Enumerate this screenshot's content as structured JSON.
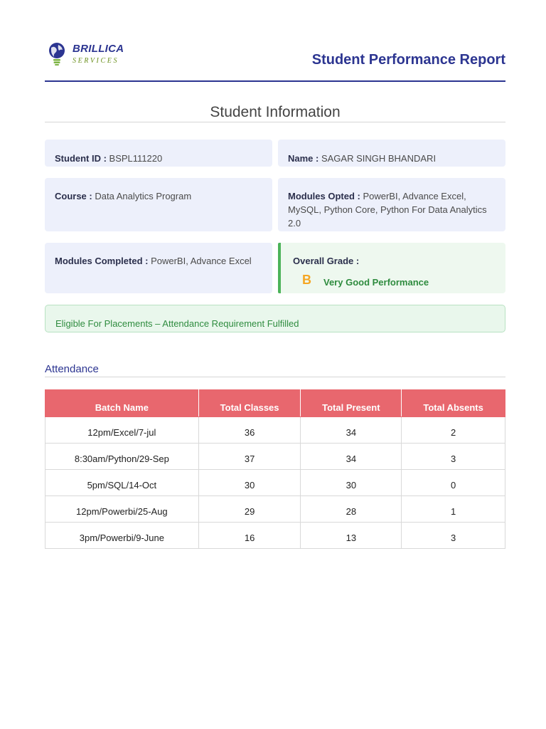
{
  "logo": {
    "brand": "BRILLICA",
    "sub": "SERVICES"
  },
  "report_title": "Student Performance Report",
  "section_title": "Student Information",
  "student": {
    "id_label": "Student ID : ",
    "id_value": "BSPL111220",
    "name_label": "Name : ",
    "name_value": "SAGAR SINGH BHANDARI",
    "course_label": "Course : ",
    "course_value": "Data Analytics Program",
    "modules_opted_label": "Modules Opted : ",
    "modules_opted_value": "PowerBI, Advance Excel, MySQL, Python Core, Python For Data Analytics 2.0",
    "modules_completed_label": "Modules Completed : ",
    "modules_completed_value": "PowerBI, Advance Excel",
    "grade_label": "Overall Grade :",
    "grade_letter": "B",
    "grade_desc": "Very Good Performance"
  },
  "eligibility": "Eligible For Placements – Attendance Requirement Fulfilled",
  "attendance": {
    "title": "Attendance",
    "headers": [
      "Batch Name",
      "Total Classes",
      "Total Present",
      "Total Absents"
    ],
    "rows": [
      [
        "12pm/Excel/7-jul",
        "36",
        "34",
        "2"
      ],
      [
        "8:30am/Python/29-Sep",
        "37",
        "34",
        "3"
      ],
      [
        "5pm/SQL/14-Oct",
        "30",
        "30",
        "0"
      ],
      [
        "12pm/Powerbi/25-Aug",
        "29",
        "28",
        "1"
      ],
      [
        "3pm/Powerbi/9-June",
        "16",
        "13",
        "3"
      ]
    ]
  },
  "colors": {
    "brand": "#2c3591",
    "table_header": "#e8676e",
    "grade": "#f5a623",
    "success": "#2f8c3f",
    "card_bg": "#edf0fb"
  }
}
